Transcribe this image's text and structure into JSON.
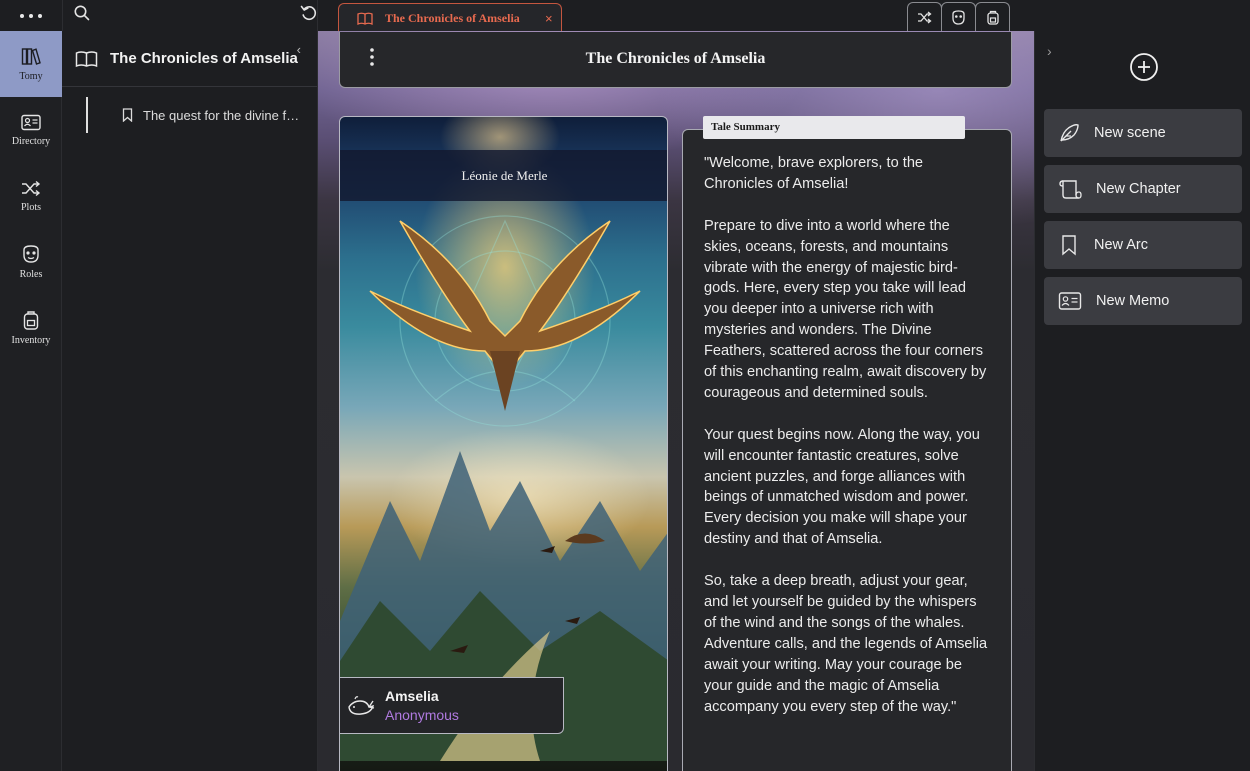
{
  "topbar": {
    "tab_title": "The Chronicles of Amselia",
    "tab_close": "×"
  },
  "rail": {
    "items": [
      {
        "label": "Tomy",
        "icon": "books-icon",
        "active": true
      },
      {
        "label": "Directory",
        "icon": "contact-card-icon"
      },
      {
        "label": "Plots",
        "icon": "shuffle-icon"
      },
      {
        "label": "Roles",
        "icon": "mask-icon"
      },
      {
        "label": "Inventory",
        "icon": "backpack-icon"
      }
    ]
  },
  "explorer": {
    "title": "The Chronicles of Amselia",
    "collapse": "‹",
    "items": [
      {
        "label": "The quest for the divine feathers"
      }
    ]
  },
  "document": {
    "title": "The Chronicles of Amselia"
  },
  "cover": {
    "author": "Léonie de Merle",
    "world": "Amselia",
    "owner": "Anonymous"
  },
  "summary": {
    "tag": "Tale Summary",
    "paragraphs": [
      "\"Welcome, brave explorers, to the Chronicles of Amselia!",
      "Prepare to dive into a world where the skies, oceans, forests, and mountains vibrate with the energy of majestic bird-gods. Here, every step you take will lead you deeper into a universe rich with mysteries and wonders. The Divine Feathers, scattered across the four corners of this enchanting realm, await discovery by courageous and determined souls.",
      "Your quest begins now. Along the way, you will encounter fantastic creatures, solve ancient puzzles, and forge alliances with beings of unmatched wisdom and power. Every decision you make will shape your destiny and that of Amselia.",
      "So, take a deep breath, adjust your gear, and let yourself be guided by the whispers of the wind and the songs of the whales. Adventure calls, and the legends of Amselia await your writing. May your courage be your guide and the magic of Amselia accompany you every step of the way.\""
    ]
  },
  "rightpanel": {
    "chevron": "›",
    "actions": [
      {
        "label": "New scene",
        "icon": "feather-icon"
      },
      {
        "label": "New Chapter",
        "icon": "scroll-icon"
      },
      {
        "label": "New Arc",
        "icon": "bookmark-icon"
      },
      {
        "label": "New Memo",
        "icon": "memo-card-icon"
      }
    ]
  },
  "colors": {
    "accent": "#e86a4f",
    "rail_active": "#8e9ac6",
    "owner": "#b07ae0"
  }
}
